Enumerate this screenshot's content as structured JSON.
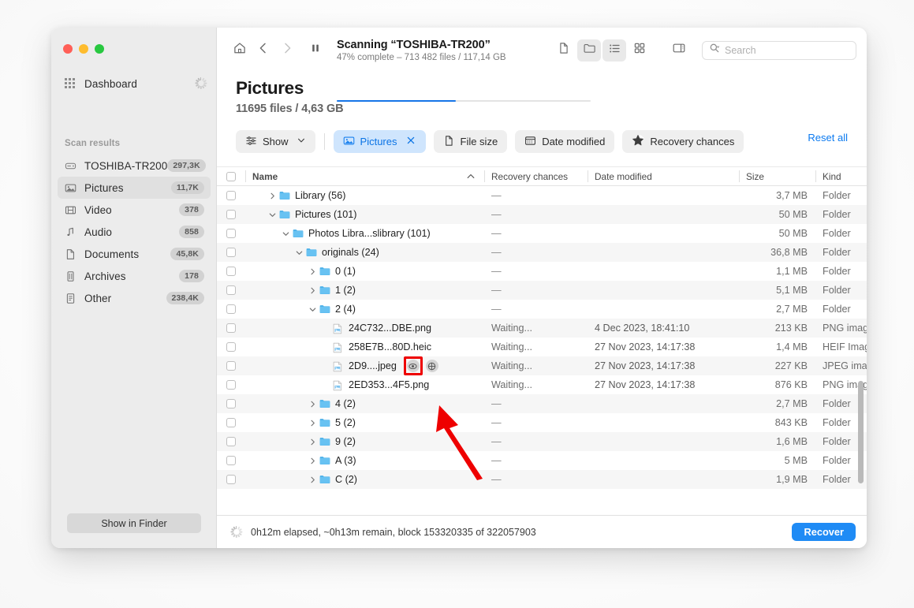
{
  "window": {
    "traffic_lights": [
      "close",
      "minimize",
      "zoom"
    ]
  },
  "sidebar": {
    "dashboard": {
      "label": "Dashboard",
      "icon": "grid-icon",
      "busy_icon": "spinner-icon"
    },
    "section_title": "Scan results",
    "items": [
      {
        "label": "TOSHIBA-TR200",
        "badge": "297,3K",
        "icon": "drive-icon",
        "active": false
      },
      {
        "label": "Pictures",
        "badge": "11,7K",
        "icon": "picture-icon",
        "active": true
      },
      {
        "label": "Video",
        "badge": "378",
        "icon": "film-icon",
        "active": false
      },
      {
        "label": "Audio",
        "badge": "858",
        "icon": "note-icon",
        "active": false
      },
      {
        "label": "Documents",
        "badge": "45,8K",
        "icon": "document-icon",
        "active": false
      },
      {
        "label": "Archives",
        "badge": "178",
        "icon": "archive-icon",
        "active": false
      },
      {
        "label": "Other",
        "badge": "238,4K",
        "icon": "other-file-icon",
        "active": false
      }
    ],
    "show_in_finder": "Show in Finder"
  },
  "toolbar": {
    "home_icon": "home-icon",
    "back_icon": "chevron-left-icon",
    "forward_icon": "chevron-right-icon",
    "pause_icon": "pause-icon",
    "scan_title": "Scanning “TOSHIBA-TR200”",
    "scan_subtitle": "47% complete – 713 482 files / 117,14 GB",
    "progress_percent": 47,
    "progress_color": "#1675e8",
    "view_buttons": [
      {
        "name": "file-view-button",
        "icon": "page-icon",
        "active": false
      },
      {
        "name": "folder-view-button",
        "icon": "folder-icon",
        "active": true
      },
      {
        "name": "list-view-button",
        "icon": "list-icon",
        "active": true
      },
      {
        "name": "grid-view-button",
        "icon": "grid-view-icon",
        "active": false
      },
      {
        "name": "sidebar-toggle-button",
        "icon": "panel-icon",
        "active": false
      }
    ],
    "search_placeholder": "Search",
    "search_value": "",
    "search_icon": "search-icon"
  },
  "header": {
    "title": "Pictures",
    "subtitle": "11695 files / 4,63 GB"
  },
  "filters": {
    "show": {
      "label": "Show",
      "icon": "sliders-icon",
      "caret": "chevron-down-icon"
    },
    "chips": [
      {
        "label": "Pictures",
        "icon": "picture-icon",
        "selected": true,
        "close": "close-icon"
      },
      {
        "label": "File size",
        "icon": "document-icon",
        "selected": false
      },
      {
        "label": "Date modified",
        "icon": "calendar-icon",
        "selected": false
      },
      {
        "label": "Recovery chances",
        "icon": "star-icon",
        "selected": false
      }
    ],
    "reset": "Reset all",
    "accent": "#0b7af0"
  },
  "table": {
    "columns": [
      "Name",
      "Recovery chances",
      "Date modified",
      "Size",
      "Kind"
    ],
    "sort_caret": "︿",
    "rows": [
      {
        "indent": 1,
        "twisty": "collapsed",
        "icon": "folder-icon",
        "name": "Library (56)",
        "recovery": "—",
        "date": "",
        "size": "3,7 MB",
        "kind": "Folder"
      },
      {
        "indent": 1,
        "twisty": "expanded",
        "icon": "folder-icon",
        "name": "Pictures (101)",
        "recovery": "—",
        "date": "",
        "size": "50 MB",
        "kind": "Folder"
      },
      {
        "indent": 2,
        "twisty": "expanded",
        "icon": "folder-icon",
        "name": "Photos Libra...slibrary (101)",
        "recovery": "—",
        "date": "",
        "size": "50 MB",
        "kind": "Folder"
      },
      {
        "indent": 3,
        "twisty": "expanded",
        "icon": "folder-icon",
        "name": "originals (24)",
        "recovery": "—",
        "date": "",
        "size": "36,8 MB",
        "kind": "Folder"
      },
      {
        "indent": 4,
        "twisty": "collapsed",
        "icon": "folder-icon",
        "name": "0 (1)",
        "recovery": "—",
        "date": "",
        "size": "1,1 MB",
        "kind": "Folder"
      },
      {
        "indent": 4,
        "twisty": "collapsed",
        "icon": "folder-icon",
        "name": "1 (2)",
        "recovery": "—",
        "date": "",
        "size": "5,1 MB",
        "kind": "Folder"
      },
      {
        "indent": 4,
        "twisty": "expanded",
        "icon": "folder-icon",
        "name": "2 (4)",
        "recovery": "—",
        "date": "",
        "size": "2,7 MB",
        "kind": "Folder"
      },
      {
        "indent": 5,
        "twisty": "none",
        "icon": "image-file-icon",
        "name": "24C732...DBE.png",
        "recovery": "Waiting...",
        "date": "4 Dec 2023, 18:41:10",
        "size": "213 KB",
        "kind": "PNG image"
      },
      {
        "indent": 5,
        "twisty": "none",
        "icon": "image-file-icon",
        "name": "258E7B...80D.heic",
        "recovery": "Waiting...",
        "date": "27 Nov 2023, 14:17:38",
        "size": "1,4 MB",
        "kind": "HEIF Image"
      },
      {
        "indent": 5,
        "twisty": "none",
        "icon": "image-file-icon",
        "name": "2D9....jpeg",
        "recovery": "Waiting...",
        "date": "27 Nov 2023, 14:17:38",
        "size": "227 KB",
        "kind": "JPEG ima...",
        "hovered": true,
        "actions": [
          "preview-eye-icon",
          "target-icon"
        ]
      },
      {
        "indent": 5,
        "twisty": "none",
        "icon": "image-file-icon",
        "name": "2ED353...4F5.png",
        "recovery": "Waiting...",
        "date": "27 Nov 2023, 14:17:38",
        "size": "876 KB",
        "kind": "PNG image"
      },
      {
        "indent": 4,
        "twisty": "collapsed",
        "icon": "folder-icon",
        "name": "4 (2)",
        "recovery": "—",
        "date": "",
        "size": "2,7 MB",
        "kind": "Folder"
      },
      {
        "indent": 4,
        "twisty": "collapsed",
        "icon": "folder-icon",
        "name": "5 (2)",
        "recovery": "—",
        "date": "",
        "size": "843 KB",
        "kind": "Folder"
      },
      {
        "indent": 4,
        "twisty": "collapsed",
        "icon": "folder-icon",
        "name": "9 (2)",
        "recovery": "—",
        "date": "",
        "size": "1,6 MB",
        "kind": "Folder"
      },
      {
        "indent": 4,
        "twisty": "collapsed",
        "icon": "folder-icon",
        "name": "A (3)",
        "recovery": "—",
        "date": "",
        "size": "5 MB",
        "kind": "Folder"
      },
      {
        "indent": 4,
        "twisty": "collapsed",
        "icon": "folder-icon",
        "name": "C (2)",
        "recovery": "—",
        "date": "",
        "size": "1,9 MB",
        "kind": "Folder"
      }
    ]
  },
  "status": {
    "busy_icon": "spinner-icon",
    "text": "0h12m elapsed, ~0h13m remain, block 153320335 of 322057903",
    "recover_label": "Recover",
    "recover_color": "#1f8bf5"
  },
  "annotation": {
    "highlight_color": "#ee0000",
    "highlight_target": "preview-eye-icon",
    "arrow": "red-arrow-pointing-up-left"
  }
}
